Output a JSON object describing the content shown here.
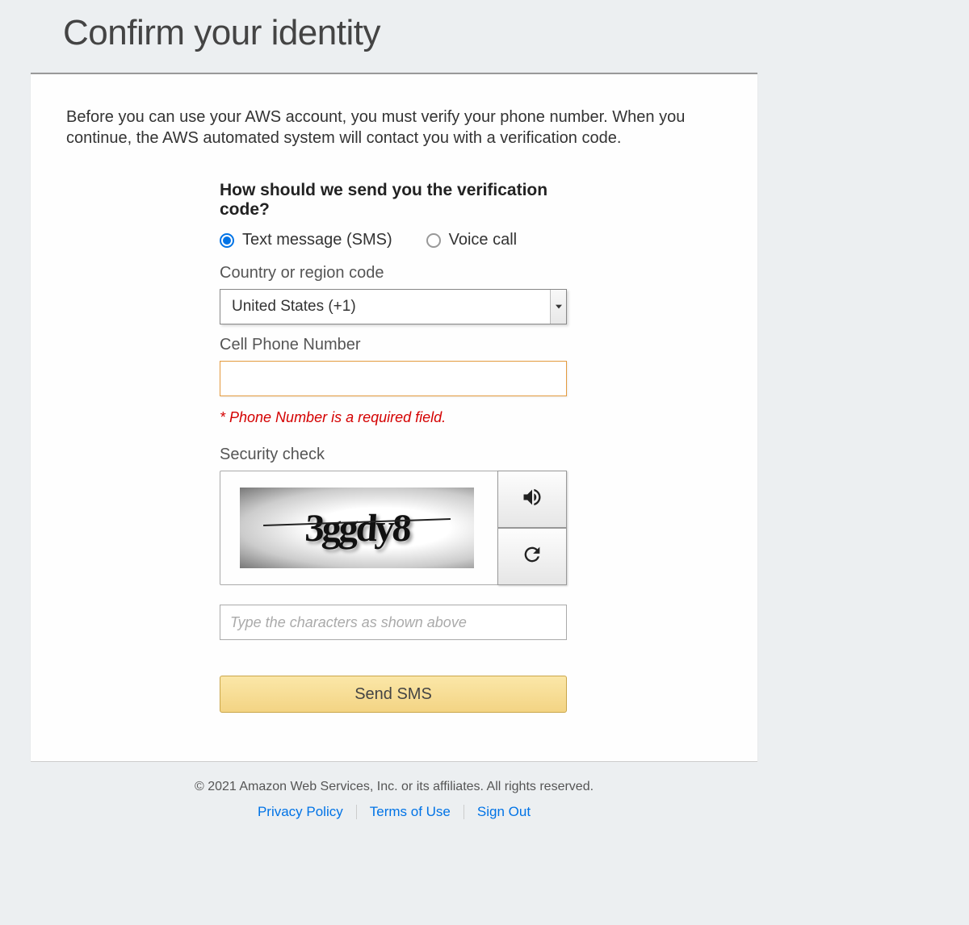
{
  "page": {
    "title": "Confirm your identity",
    "intro": "Before you can use your AWS account, you must verify your phone number. When you continue, the AWS automated system will contact you with a verification code."
  },
  "verification": {
    "question": "How should we send you the verification code?",
    "options": {
      "sms": {
        "label": "Text message (SMS)",
        "checked": true
      },
      "voice": {
        "label": "Voice call",
        "checked": false
      }
    }
  },
  "country": {
    "label": "Country or region code",
    "selected": "United States (+1)"
  },
  "phone": {
    "label": "Cell Phone Number",
    "value": "",
    "error": "* Phone Number is a required field."
  },
  "security": {
    "label": "Security check",
    "captcha_text": "3ggdy8",
    "input_placeholder": "Type the characters as shown above"
  },
  "submit": {
    "label": "Send SMS"
  },
  "footer": {
    "copyright": "© 2021 Amazon Web Services, Inc. or its affiliates. All rights reserved.",
    "links": {
      "privacy": "Privacy Policy",
      "terms": "Terms of Use",
      "signout": "Sign Out"
    }
  }
}
